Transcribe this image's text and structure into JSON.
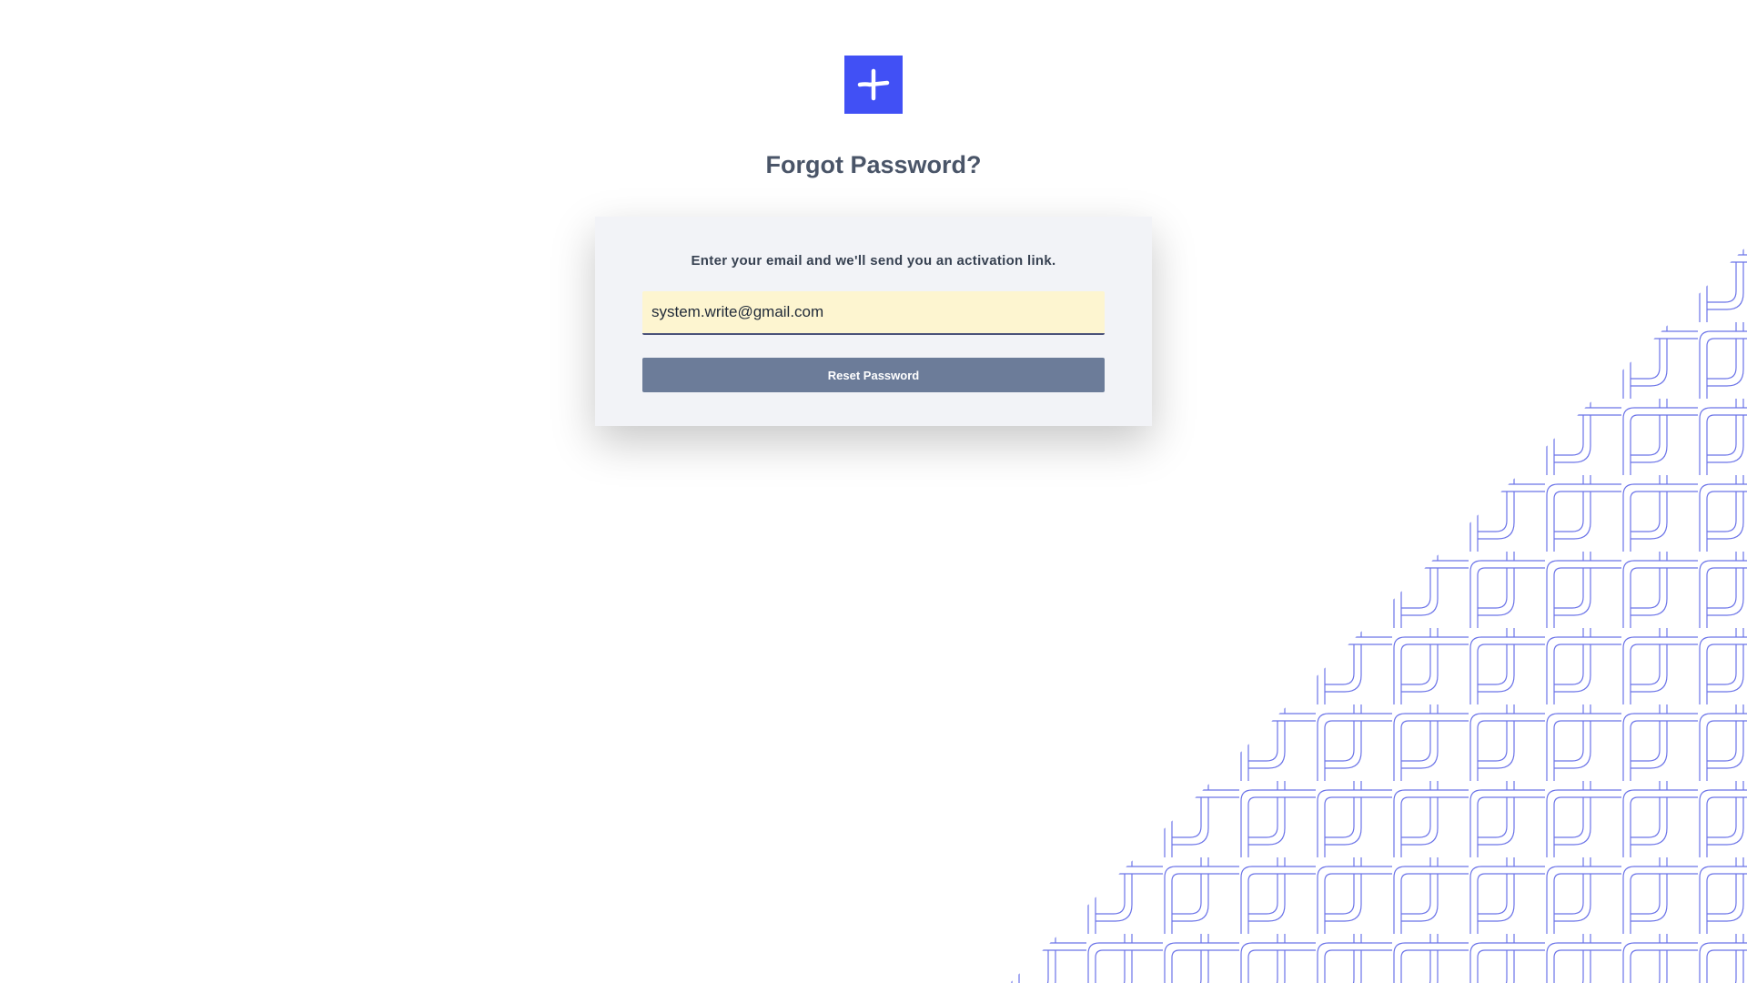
{
  "logo": {
    "icon": "plus-icon",
    "background_color": "#4150f5"
  },
  "page": {
    "title": "Forgot Password?"
  },
  "form": {
    "instructions": "Enter your email and we'll send you an activation link.",
    "email_value": "system.write@gmail.com",
    "email_placeholder": "",
    "submit_label": "Reset Password",
    "button_color": "#6c7c99",
    "input_background": "#fdf5d0"
  },
  "decoration": {
    "pattern": "pipe-pattern",
    "stroke_color": "#6b73e8"
  }
}
